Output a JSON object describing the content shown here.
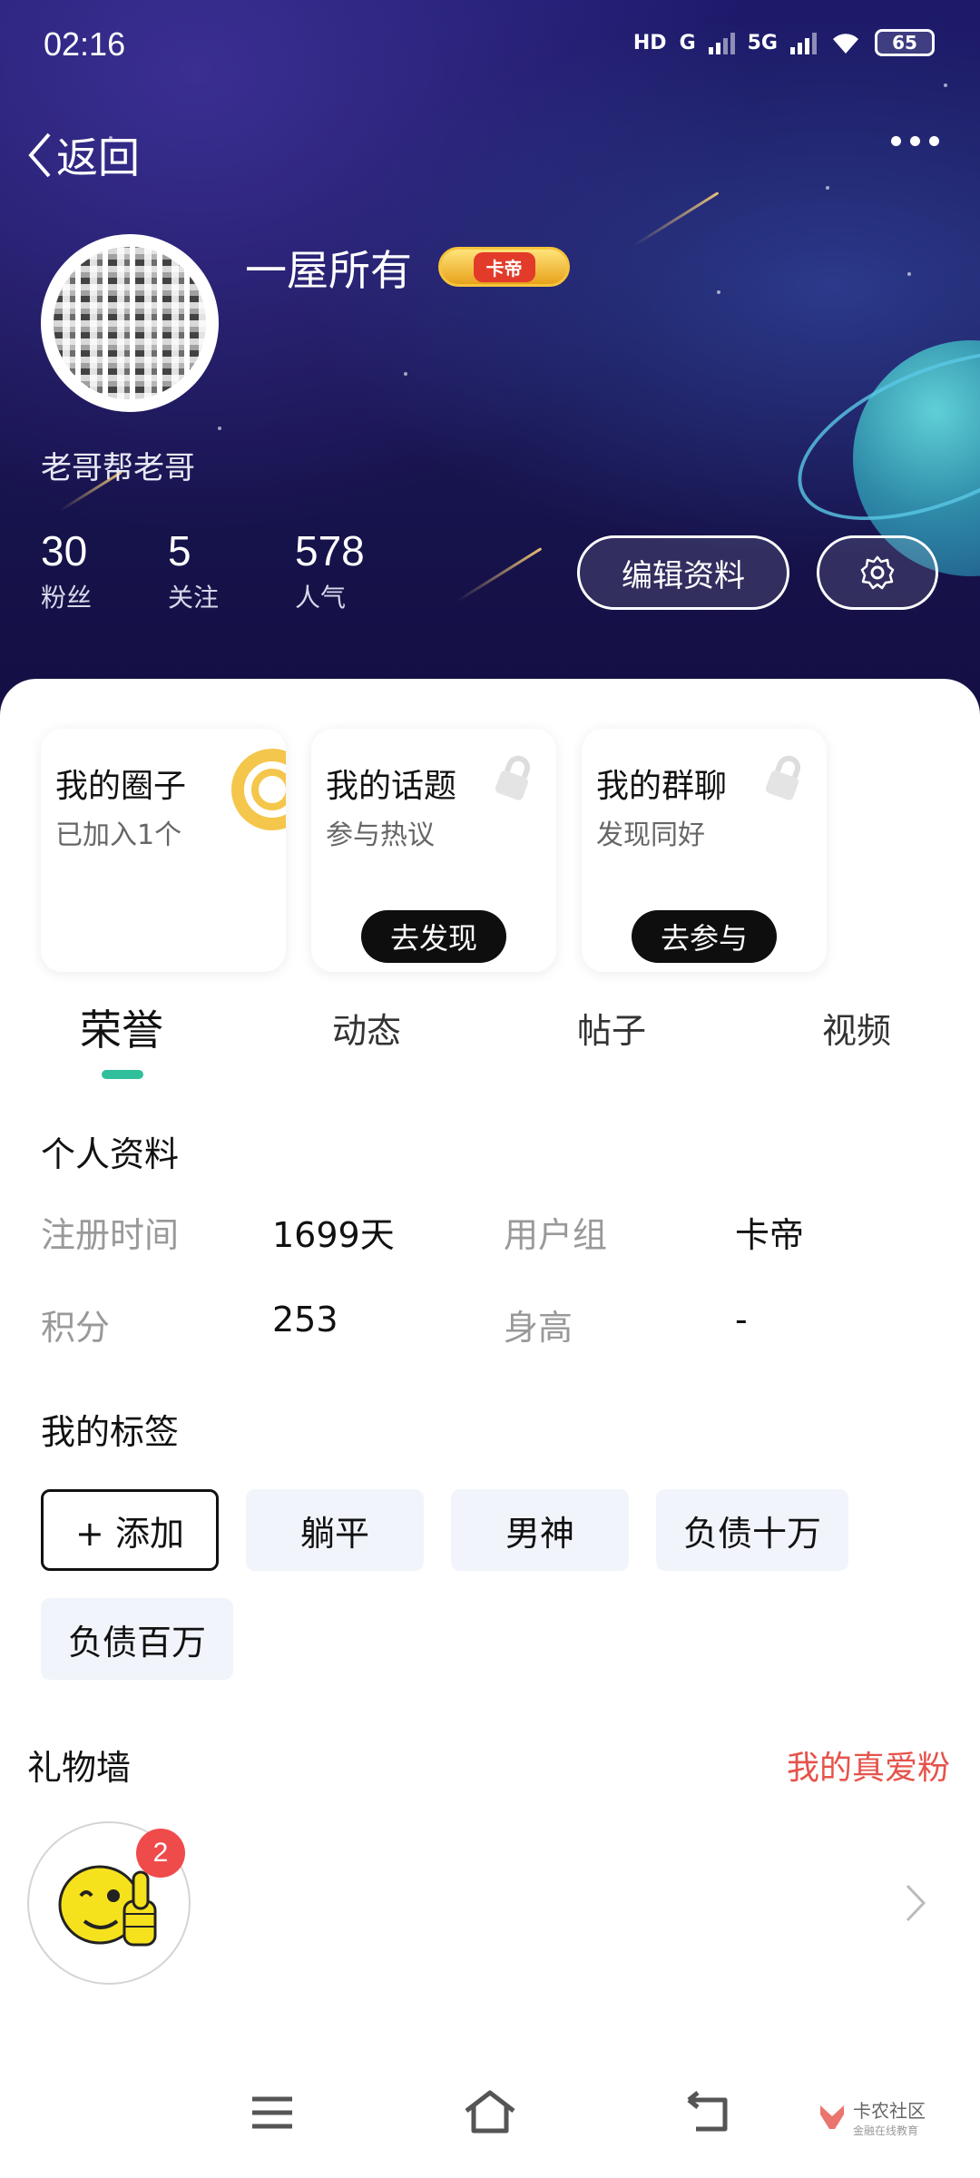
{
  "status_bar": {
    "time": "02:16",
    "network_1": "HD",
    "network_2": "G",
    "network_3": "5G",
    "battery": "65"
  },
  "nav": {
    "back_label": "返回"
  },
  "profile": {
    "username": "一屋所有",
    "badge": "卡帝",
    "signature": "老哥帮老哥",
    "stats": [
      {
        "value": "30",
        "label": "粉丝"
      },
      {
        "value": "5",
        "label": "关注"
      },
      {
        "value": "578",
        "label": "人气"
      }
    ],
    "edit_label": "编辑资料"
  },
  "cards": [
    {
      "title": "我的圈子",
      "subtitle": "已加入1个"
    },
    {
      "title": "我的话题",
      "subtitle": "参与热议",
      "action": "去发现"
    },
    {
      "title": "我的群聊",
      "subtitle": "发现同好",
      "action": "去参与"
    }
  ],
  "tabs": [
    "荣誉",
    "动态",
    "帖子",
    "视频"
  ],
  "personal_info": {
    "title": "个人资料",
    "rows": [
      {
        "label": "注册时间",
        "value": "1699天",
        "label2": "用户组",
        "value2": "卡帝"
      },
      {
        "label": "积分",
        "value": "253",
        "label2": "身高",
        "value2": "-"
      }
    ]
  },
  "tags_section": {
    "title": "我的标签",
    "add_label": "+ 添加",
    "tags": [
      "躺平",
      "男神",
      "负债十万",
      "负债百万"
    ]
  },
  "gift_wall": {
    "title": "礼物墙",
    "link": "我的真爱粉",
    "count": "2"
  },
  "watermark": {
    "name": "卡农社区",
    "sub": "金融在线教育"
  },
  "colors": {
    "accent": "#2fbf9a",
    "link_red": "#e5534b",
    "badge_red": "#ef4b4b"
  }
}
